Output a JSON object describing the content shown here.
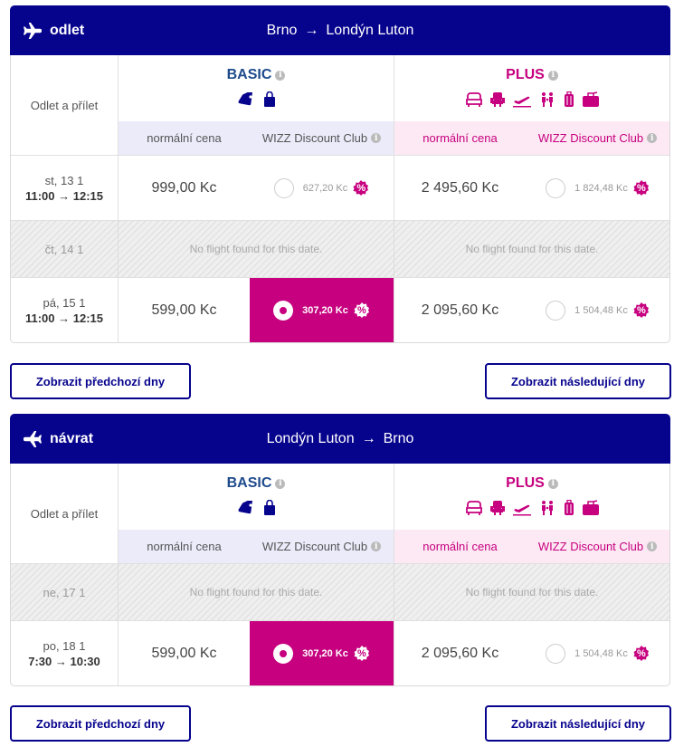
{
  "colors": {
    "navy": "#06038d",
    "magenta": "#c6007e",
    "basic_blue": "#1e4a8c"
  },
  "labels": {
    "date_header": "Odlet a přílet",
    "basic": "BASIC",
    "plus": "PLUS",
    "normal_price": "normální cena",
    "club": "WIZZ Discount Club",
    "info_icon": "i",
    "discount_badge": "%",
    "no_flight": "No flight found for this date.",
    "prev_days": "Zobrazit předchozí dny",
    "next_days": "Zobrazit následující dny"
  },
  "basic_icons": [
    "tag-icon",
    "small-bag-icon"
  ],
  "plus_icons": [
    "seat-icon",
    "chair-icon",
    "airplane-departure-icon",
    "family-icon",
    "trolley-icon",
    "suitcase-icon"
  ],
  "outbound": {
    "direction": "odlet",
    "from": "Brno",
    "arrow": "→",
    "to": "Londýn Luton",
    "rows": [
      {
        "date": "st, 13 1",
        "time": "11:00 → 12:15",
        "basic_price": "999,00 Kc",
        "basic_club": "627,20 Kc",
        "basic_selected": false,
        "plus_price": "2 495,60 Kc",
        "plus_club": "1 824,48 Kc"
      },
      {
        "date": "čt, 14 1",
        "empty": true
      },
      {
        "date": "pá, 15 1",
        "time": "11:00 → 12:15",
        "basic_price": "599,00 Kc",
        "basic_club": "307,20 Kc",
        "basic_selected": true,
        "plus_price": "2 095,60 Kc",
        "plus_club": "1 504,48 Kc"
      }
    ]
  },
  "inbound": {
    "direction": "návrat",
    "from": "Londýn Luton",
    "arrow": "→",
    "to": "Brno",
    "rows": [
      {
        "date": "ne, 17 1",
        "empty": true
      },
      {
        "date": "po, 18 1",
        "time": "7:30 → 10:30",
        "basic_price": "599,00 Kc",
        "basic_club": "307,20 Kc",
        "basic_selected": true,
        "plus_price": "2 095,60 Kc",
        "plus_club": "1 504,48 Kc"
      }
    ]
  }
}
